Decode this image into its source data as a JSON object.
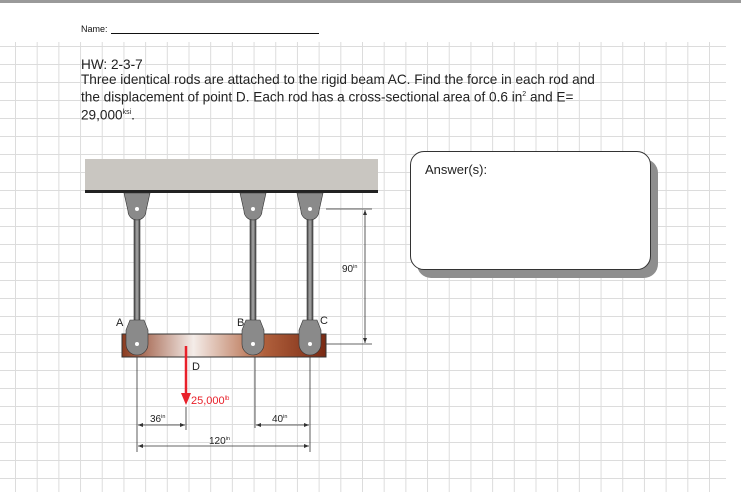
{
  "header": {
    "name_label": "Name:"
  },
  "problem": {
    "id": "HW: 2-3-7",
    "line1": "Three identical rods are attached to the rigid beam AC.  Find the force in each rod and",
    "line2a": "the displacement of point D.  Each rod has a cross-sectional area of 0.6 in",
    "line2_sup": "2",
    "line2b": " and E=",
    "line3a": "29,000",
    "line3_sup": "ksi",
    "line3b": "."
  },
  "answer_box": {
    "label": "Answer(s):"
  },
  "diagram": {
    "points": {
      "a": "A",
      "b": "B",
      "c": "C",
      "d": "D"
    },
    "load": "25,000",
    "load_unit": "lb",
    "dim_rod_length": "90",
    "dim_rod_unit": "in",
    "dim_ad": "36",
    "dim_ad_unit": "in",
    "dim_bc": "40",
    "dim_bc_unit": "in",
    "dim_ac": "120",
    "dim_ac_unit": "in",
    "colors": {
      "load": "#e8202a",
      "beam": "#8a3a1e",
      "ceiling": "#c9c6c1"
    }
  }
}
